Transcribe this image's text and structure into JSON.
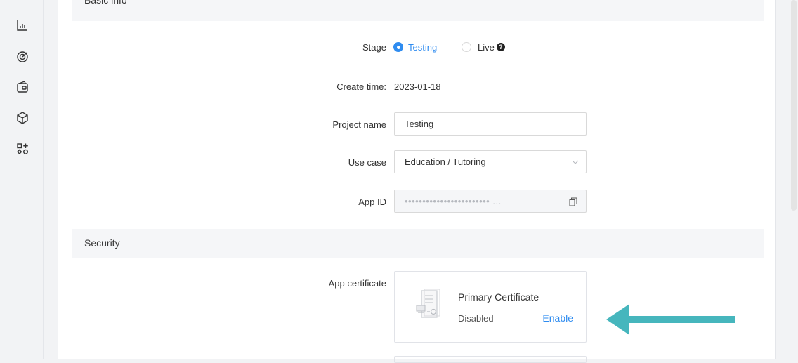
{
  "sidebar": {
    "icons": [
      "analytics-icon",
      "radar-icon",
      "wallet-icon",
      "box-icon",
      "extensions-icon"
    ]
  },
  "basic_info": {
    "section_title": "Basic info",
    "stage": {
      "label": "Stage",
      "options": [
        "Testing",
        "Live"
      ],
      "selected": "Testing"
    },
    "create_time": {
      "label": "Create time:",
      "value": "2023-01-18"
    },
    "project_name": {
      "label": "Project name",
      "value": "Testing"
    },
    "use_case": {
      "label": "Use case",
      "value": "Education / Tutoring"
    },
    "app_id": {
      "label": "App ID",
      "value": "•••••••••••••••••••••••• ..."
    }
  },
  "security": {
    "section_title": "Security",
    "app_certificate": {
      "label": "App certificate",
      "title": "Primary Certificate",
      "status": "Disabled",
      "action": "Enable"
    }
  },
  "colors": {
    "accent": "#2f8cf0",
    "arrow": "#46b6bd",
    "section_bg": "#f5f6f8"
  }
}
